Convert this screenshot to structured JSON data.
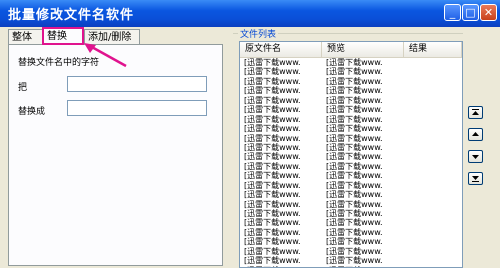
{
  "window": {
    "title": "批量修改文件名软件",
    "buttons": {
      "minimize": "_",
      "maximize": "□",
      "close": "✕"
    }
  },
  "tabs": [
    {
      "label": "整体"
    },
    {
      "label": "替换"
    },
    {
      "label": "添加/删除"
    }
  ],
  "replace_panel": {
    "section_label": "替换文件名中的字符",
    "from_label": "把",
    "from_value": "",
    "to_label": "替换成",
    "to_value": ""
  },
  "file_list": {
    "group_title": "文件列表",
    "columns": [
      "原文件名",
      "预览",
      "结果"
    ],
    "rows": [
      [
        "[迅雷下载www.",
        "[迅雷下载www.",
        ""
      ],
      [
        "[迅雷下载www.",
        "[迅雷下载www.",
        ""
      ],
      [
        "[迅雷下载www.",
        "[迅雷下载www.",
        ""
      ],
      [
        "[迅雷下载www.",
        "[迅雷下载www.",
        ""
      ],
      [
        "[迅雷下载www.",
        "[迅雷下载www.",
        ""
      ],
      [
        "[迅雷下载www.",
        "[迅雷下载www.",
        ""
      ],
      [
        "[迅雷下载www.",
        "[迅雷下载www.",
        ""
      ],
      [
        "[迅雷下载www.",
        "[迅雷下载www.",
        ""
      ],
      [
        "[迅雷下载www.",
        "[迅雷下载www.",
        ""
      ],
      [
        "[迅雷下载www.",
        "[迅雷下载www.",
        ""
      ],
      [
        "[迅雷下载www.",
        "[迅雷下载www.",
        ""
      ],
      [
        "[迅雷下载www.",
        "[迅雷下载www.",
        ""
      ],
      [
        "[迅雷下载www.",
        "[迅雷下载www.",
        ""
      ],
      [
        "[迅雷下载www.",
        "[迅雷下载www.",
        ""
      ],
      [
        "[迅雷下载www.",
        "[迅雷下载www.",
        ""
      ],
      [
        "[迅雷下载www.",
        "[迅雷下载www.",
        ""
      ],
      [
        "[迅雷下载www.",
        "[迅雷下载www.",
        ""
      ],
      [
        "[迅雷下载www.",
        "[迅雷下载www.",
        ""
      ],
      [
        "[迅雷下载www.",
        "[迅雷下载www.",
        ""
      ],
      [
        "[迅雷下载www.",
        "[迅雷下载www.",
        ""
      ],
      [
        "[迅雷下载www.",
        "[迅雷下载www.",
        ""
      ],
      [
        "[迅雷下载www.",
        "[迅雷下载www.",
        ""
      ],
      [
        "[迅雷下载www.",
        "[迅雷下载www.",
        ""
      ]
    ]
  },
  "side_buttons": [
    {
      "icon": "move-to-top-icon"
    },
    {
      "icon": "move-up-icon"
    },
    {
      "icon": "move-down-icon"
    },
    {
      "icon": "move-to-bottom-icon"
    }
  ],
  "colors": {
    "annotation": "#e0138e",
    "titlebar": "#0a56e0"
  }
}
